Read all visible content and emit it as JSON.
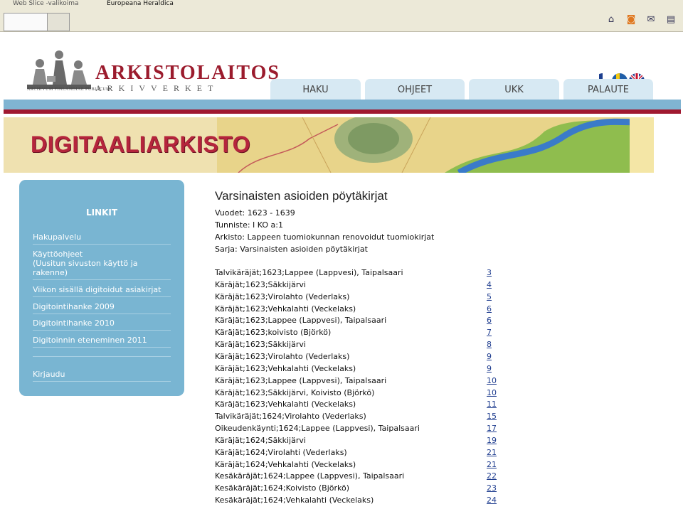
{
  "browser": {
    "webslice_label": "Web Slice -valikoima",
    "favorite_label": "Europeana Heraldica"
  },
  "logo": {
    "title": "ARKISTOLAITOS",
    "subtitle": "ARKIVVERKET",
    "caption": "ARCHIVUM FINLANDIAE PUBLICUM"
  },
  "nav": {
    "tabs": [
      {
        "label": "HAKU"
      },
      {
        "label": "OHJEET"
      },
      {
        "label": "UKK"
      },
      {
        "label": "PALAUTE"
      }
    ]
  },
  "banner": {
    "title": "DIGITAALIARKISTO"
  },
  "sidebar": {
    "heading": "LINKIT",
    "items": [
      {
        "label": "Hakupalvelu"
      },
      {
        "label": "Käyttöohjeet\n(Uusitun sivuston käyttö ja rakenne)"
      },
      {
        "label": "Viikon sisällä digitoidut asiakirjat"
      },
      {
        "label": "Digitointihanke 2009"
      },
      {
        "label": "Digitointihanke 2010"
      },
      {
        "label": "Digitoinnin eteneminen 2011"
      },
      {
        "label": "Kirjaudu"
      }
    ]
  },
  "content": {
    "title": "Varsinaisten asioiden pöytäkirjat",
    "meta": [
      "Vuodet: 1623 - 1639",
      "Tunniste: I KO a:1",
      "Arkisto: Lappeen tuomiokunnan renovoidut tuomiokirjat",
      "Sarja: Varsinaisten asioiden pöytäkirjat"
    ],
    "rows": [
      {
        "text": "Talvikäräjät;1623;Lappee (Lappvesi), Taipalsaari",
        "page": "3"
      },
      {
        "text": "Käräjät;1623;Säkkijärvi",
        "page": "4"
      },
      {
        "text": "Käräjät;1623;Virolahto (Vederlaks)",
        "page": "5"
      },
      {
        "text": "Käräjät;1623;Vehkalahti (Veckelaks)",
        "page": "6"
      },
      {
        "text": "Käräjät;1623;Lappee (Lappvesi), Taipalsaari",
        "page": "6"
      },
      {
        "text": "Käräjät;1623;koivisto (Björkö)",
        "page": "7"
      },
      {
        "text": "Käräjät;1623;Säkkijärvi",
        "page": "8"
      },
      {
        "text": "Käräjät;1623;Virolahto (Vederlaks)",
        "page": "9"
      },
      {
        "text": "Käräjät;1623;Vehkalahti (Veckelaks)",
        "page": "9"
      },
      {
        "text": "Käräjät;1623;Lappee (Lappvesi), Taipalsaari",
        "page": "10"
      },
      {
        "text": "Käräjät;1623;Säkkijärvi, Koivisto (Björkö)",
        "page": "10"
      },
      {
        "text": "Käräjät;1623;Vehkalahti (Veckelaks)",
        "page": "11"
      },
      {
        "text": "Talvikäräjät;1624;Virolahto (Vederlaks)",
        "page": "15"
      },
      {
        "text": "Oikeudenkäynti;1624;Lappee (Lappvesi), Taipalsaari",
        "page": "17"
      },
      {
        "text": "Käräjät;1624;Säkkijärvi",
        "page": "19"
      },
      {
        "text": "Käräjät;1624;Virolahti (Vederlaks)",
        "page": "21"
      },
      {
        "text": "Käräjät;1624;Vehkalahti (Veckelaks)",
        "page": "21"
      },
      {
        "text": "Kesäkäräjät;1624;Lappee (Lappvesi), Taipalsaari",
        "page": "22"
      },
      {
        "text": "Kesäkäräjät;1624;Koivisto (Björkö)",
        "page": "23"
      },
      {
        "text": "Kesäkäräjät;1624;Vehkalahti (Veckelaks)",
        "page": "24"
      }
    ]
  },
  "colors": {
    "brand_red": "#a01930",
    "nav_blue": "#80b4d2",
    "sidebar_blue": "#79b5d2",
    "link": "#1f3d8f"
  }
}
